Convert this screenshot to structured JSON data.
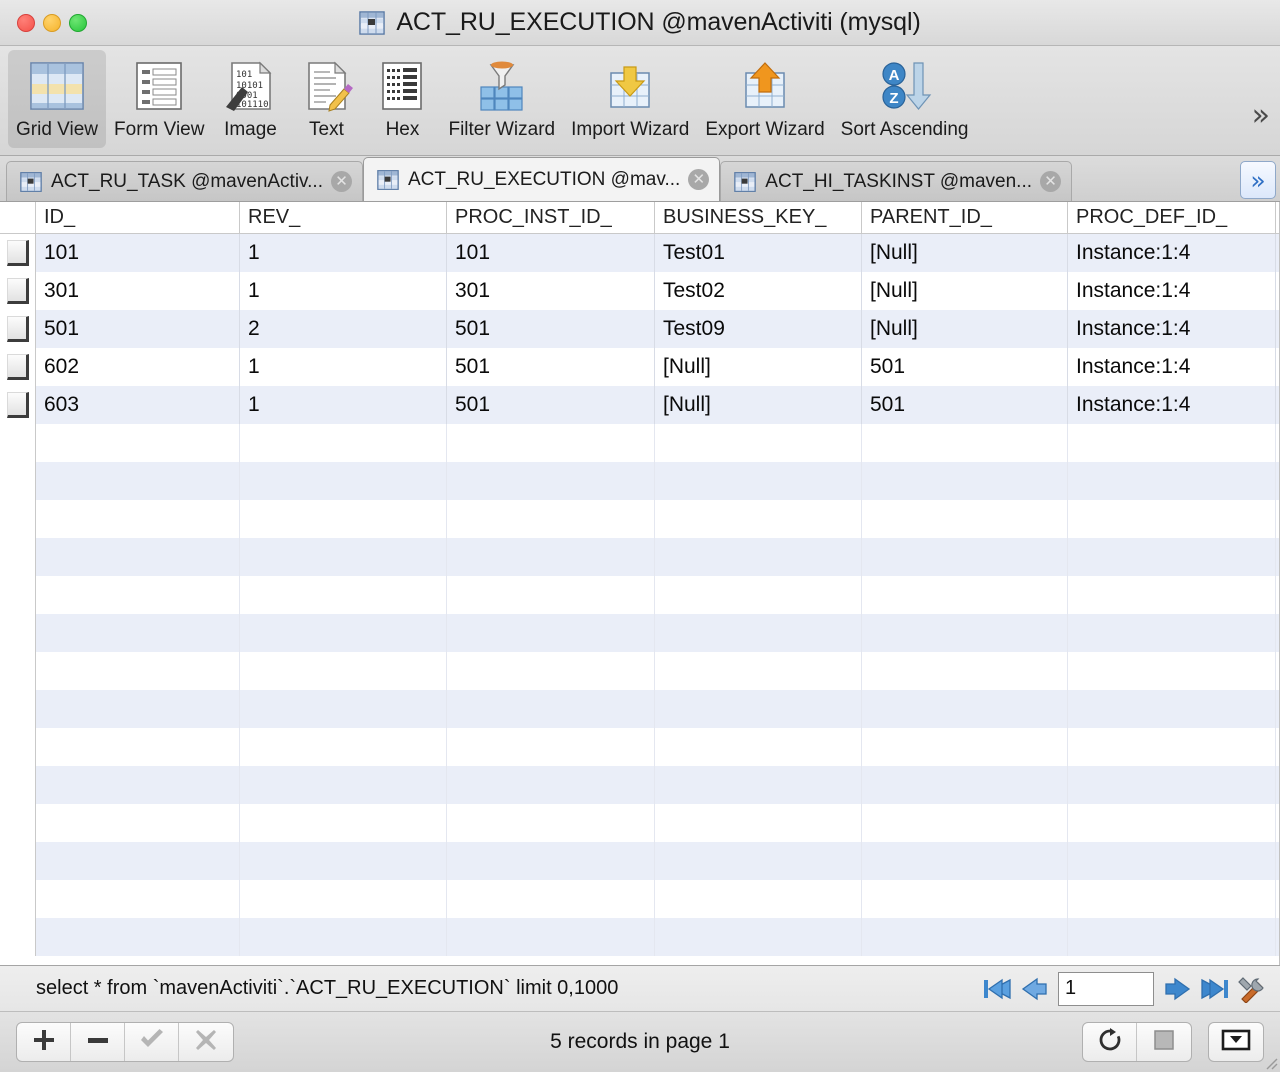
{
  "window": {
    "title": "ACT_RU_EXECUTION @mavenActiviti (mysql)",
    "title_icon": "table-icon",
    "controls": {
      "close": "close",
      "minimize": "minimize",
      "zoom": "zoom"
    }
  },
  "toolbar": {
    "overflow_label": "»",
    "items": [
      {
        "label": "Grid View",
        "icon": "grid-view-icon",
        "active": true
      },
      {
        "label": "Form View",
        "icon": "form-view-icon",
        "active": false
      },
      {
        "label": "Image",
        "icon": "image-icon",
        "active": false
      },
      {
        "label": "Text",
        "icon": "text-icon",
        "active": false
      },
      {
        "label": "Hex",
        "icon": "hex-icon",
        "active": false
      },
      {
        "label": "Filter Wizard",
        "icon": "filter-wizard-icon",
        "active": false
      },
      {
        "label": "Import Wizard",
        "icon": "import-wizard-icon",
        "active": false
      },
      {
        "label": "Export Wizard",
        "icon": "export-wizard-icon",
        "active": false
      },
      {
        "label": "Sort Ascending",
        "icon": "sort-ascending-icon",
        "active": false
      }
    ]
  },
  "tabs": {
    "overflow_label": "»",
    "close_glyph": "✕",
    "items": [
      {
        "label": "ACT_RU_TASK @mavenActiv...",
        "selected": false
      },
      {
        "label": "ACT_RU_EXECUTION @mav...",
        "selected": true
      },
      {
        "label": "ACT_HI_TASKINST @maven...",
        "selected": false
      }
    ]
  },
  "grid": {
    "columns": [
      "ID_",
      "REV_",
      "PROC_INST_ID_",
      "BUSINESS_KEY_",
      "PARENT_ID_",
      "PROC_DEF_ID_"
    ],
    "rows": [
      [
        "101",
        "1",
        "101",
        "Test01",
        "[Null]",
        "Instance:1:4"
      ],
      [
        "301",
        "1",
        "301",
        "Test02",
        "[Null]",
        "Instance:1:4"
      ],
      [
        "501",
        "2",
        "501",
        "Test09",
        "[Null]",
        "Instance:1:4"
      ],
      [
        "602",
        "1",
        "501",
        "[Null]",
        "501",
        "Instance:1:4"
      ],
      [
        "603",
        "1",
        "501",
        "[Null]",
        "501",
        "Instance:1:4"
      ]
    ],
    "empty_row_count": 14,
    "alt_row_color": "#eaeef8",
    "row_color": "#ffffff"
  },
  "statusbar": {
    "sql": "select * from `mavenActiviti`.`ACT_RU_EXECUTION`  limit 0,1000",
    "page_value": "1",
    "page_placeholder": "",
    "nav": {
      "first": "first-page-icon",
      "prev": "previous-page-icon",
      "next": "next-page-icon",
      "last": "last-page-icon",
      "tools": "tools-icon"
    }
  },
  "bottombar": {
    "records_text": "5 records in page 1",
    "buttons": [
      {
        "name": "add-record-button",
        "icon": "plus-icon",
        "enabled": true
      },
      {
        "name": "delete-record-button",
        "icon": "minus-icon",
        "enabled": true
      },
      {
        "name": "apply-changes-button",
        "icon": "check-icon",
        "enabled": false
      },
      {
        "name": "cancel-changes-button",
        "icon": "cross-icon",
        "enabled": false
      }
    ],
    "right_buttons": [
      {
        "name": "refresh-button",
        "icon": "refresh-icon"
      },
      {
        "name": "stop-button",
        "icon": "stop-icon"
      },
      {
        "name": "options-button",
        "icon": "dropdown-box-icon"
      }
    ]
  },
  "colors": {
    "accent_blue": "#2f6fc4",
    "alt_row": "#eaeef8",
    "chrome": "#e3e3e3"
  }
}
